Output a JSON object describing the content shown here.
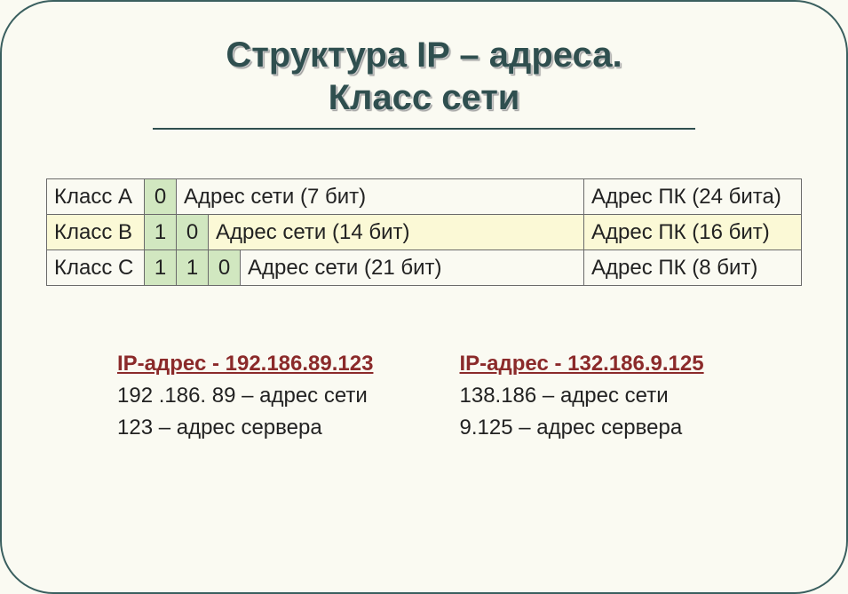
{
  "title": {
    "line1": "Структура IP – адреса.",
    "line2": "Класс сети"
  },
  "table": {
    "rowA": {
      "class": "Класс А",
      "b0": "0",
      "net": "Адрес сети (7 бит)",
      "pc": "Адрес ПК (24 бита)"
    },
    "rowB": {
      "class": "Класс В",
      "b0": "1",
      "b1": "0",
      "net": "Адрес сети (14 бит)",
      "pc": "Адрес ПК (16 бит)"
    },
    "rowC": {
      "class": "Класс С",
      "b0": "1",
      "b1": "1",
      "b2": "0",
      "net": "Адрес сети (21 бит)",
      "pc": "Адрес ПК (8 бит)"
    }
  },
  "examples": {
    "left": {
      "head": "IP-адрес - 192.186.89.123",
      "l1": "192 .186. 89 – адрес сети",
      "l2": "123 – адрес сервера"
    },
    "right": {
      "head": "IP-адрес - 132.186.9.125",
      "l1": "138.186 – адрес сети",
      "l2": "9.125 – адрес сервера"
    }
  }
}
